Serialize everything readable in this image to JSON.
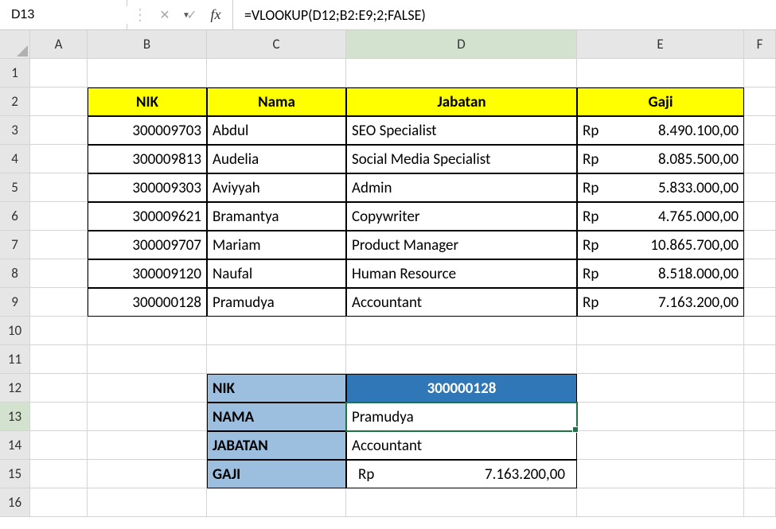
{
  "nameBox": "D13",
  "formula": "=VLOOKUP(D12;B2:E9;2;FALSE)",
  "columns": [
    "A",
    "B",
    "C",
    "D",
    "E",
    "F"
  ],
  "rows": [
    "1",
    "2",
    "3",
    "4",
    "5",
    "6",
    "7",
    "8",
    "9",
    "10",
    "11",
    "12",
    "13",
    "14",
    "15",
    "16"
  ],
  "activeCol": "D",
  "activeRow": "13",
  "headers": {
    "nik": "NIK",
    "nama": "Nama",
    "jabatan": "Jabatan",
    "gaji": "Gaji"
  },
  "data": [
    {
      "nik": "300009703",
      "nama": "Abdul",
      "jabatan": "SEO Specialist",
      "gaji_cur": "Rp",
      "gaji_val": "8.490.100,00"
    },
    {
      "nik": "300009813",
      "nama": "Audelia",
      "jabatan": "Social Media Specialist",
      "gaji_cur": "Rp",
      "gaji_val": "8.085.500,00"
    },
    {
      "nik": "300009303",
      "nama": "Aviyyah",
      "jabatan": "Admin",
      "gaji_cur": "Rp",
      "gaji_val": "5.833.000,00"
    },
    {
      "nik": "300009621",
      "nama": "Bramantya",
      "jabatan": "Copywriter",
      "gaji_cur": "Rp",
      "gaji_val": "4.765.000,00"
    },
    {
      "nik": "300009707",
      "nama": "Mariam",
      "jabatan": "Product Manager",
      "gaji_cur": "Rp",
      "gaji_val": "10.865.700,00"
    },
    {
      "nik": "300009120",
      "nama": "Naufal",
      "jabatan": "Human Resource",
      "gaji_cur": "Rp",
      "gaji_val": "8.518.000,00"
    },
    {
      "nik": "300000128",
      "nama": "Pramudya",
      "jabatan": "Accountant",
      "gaji_cur": "Rp",
      "gaji_val": "7.163.200,00"
    }
  ],
  "lookup": {
    "labels": {
      "nik": "NIK",
      "nama": "NAMA",
      "jabatan": "JABATAN",
      "gaji": "GAJI"
    },
    "nik": "300000128",
    "nama": "Pramudya",
    "jabatan": "Accountant",
    "gaji_cur": "Rp",
    "gaji_val": "7.163.200,00"
  }
}
